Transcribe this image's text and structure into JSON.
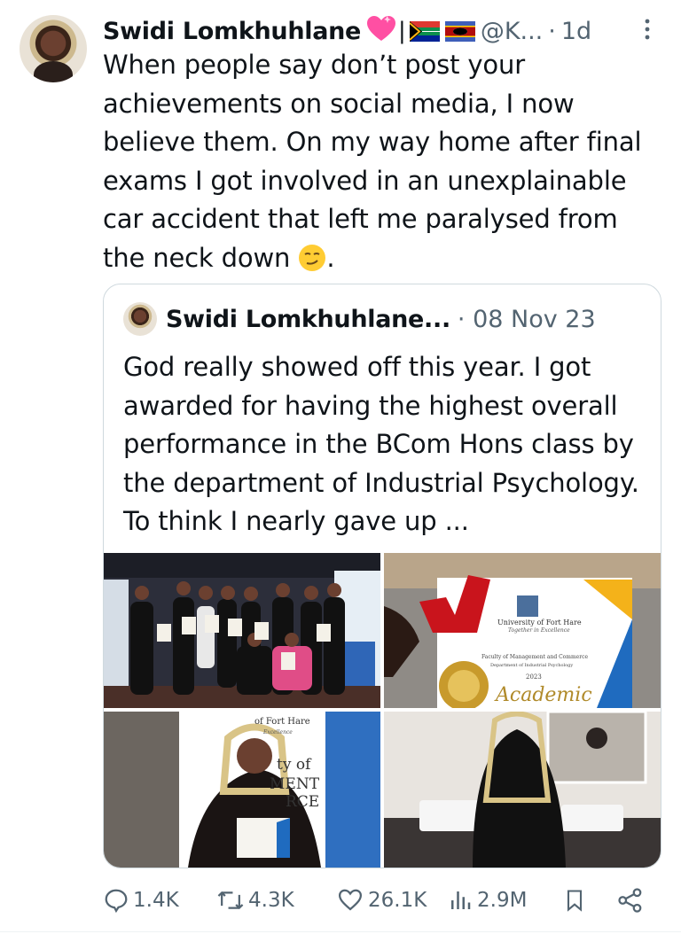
{
  "tweet": {
    "author_name": "Swidi Lomkhuhlane",
    "name_separator": "|",
    "handle": "@K...",
    "dot": "·",
    "time": "1d",
    "text": "When people say don’t post your achievements on social media, I now believe them. On my way home after final exams I got involved in an unexplainable car accident that left me paralysed from the neck down",
    "text_suffix": "."
  },
  "quoted": {
    "author_name": "Swidi Lomkhuhlane...",
    "date": "· 08 Nov 23",
    "text": "God really showed off this year. I got awarded for having the highest overall performance in the BCom Hons class by the department of Industrial Psychology. To think I nearly gave up ...",
    "photos": {
      "medal_card": {
        "line1": "University of Fort Hare",
        "line2": "Together in Excellence",
        "line3": "Faculty of Management and Commerce",
        "line4": "Department of Industrial Psychology",
        "year": "2023",
        "award": "Academic"
      },
      "banner": {
        "line1": "of Fort Hare",
        "line2": "Excellence",
        "line3": "ty of",
        "line4": "MENT",
        "line5": "RCE"
      }
    }
  },
  "actions": {
    "replies": "1.4K",
    "reposts": "4.3K",
    "likes": "26.1K",
    "views": "2.9M"
  },
  "icons": [
    "more-icon",
    "reply-icon",
    "repost-icon",
    "like-icon",
    "views-icon",
    "bookmark-icon",
    "share-icon",
    "sparkling-heart-emoji",
    "south-africa-flag",
    "eswatini-flag",
    "smirking-face-emoji"
  ],
  "colors": {
    "muted": "#536471",
    "text": "#0f1419",
    "border": "#cfd9de"
  }
}
